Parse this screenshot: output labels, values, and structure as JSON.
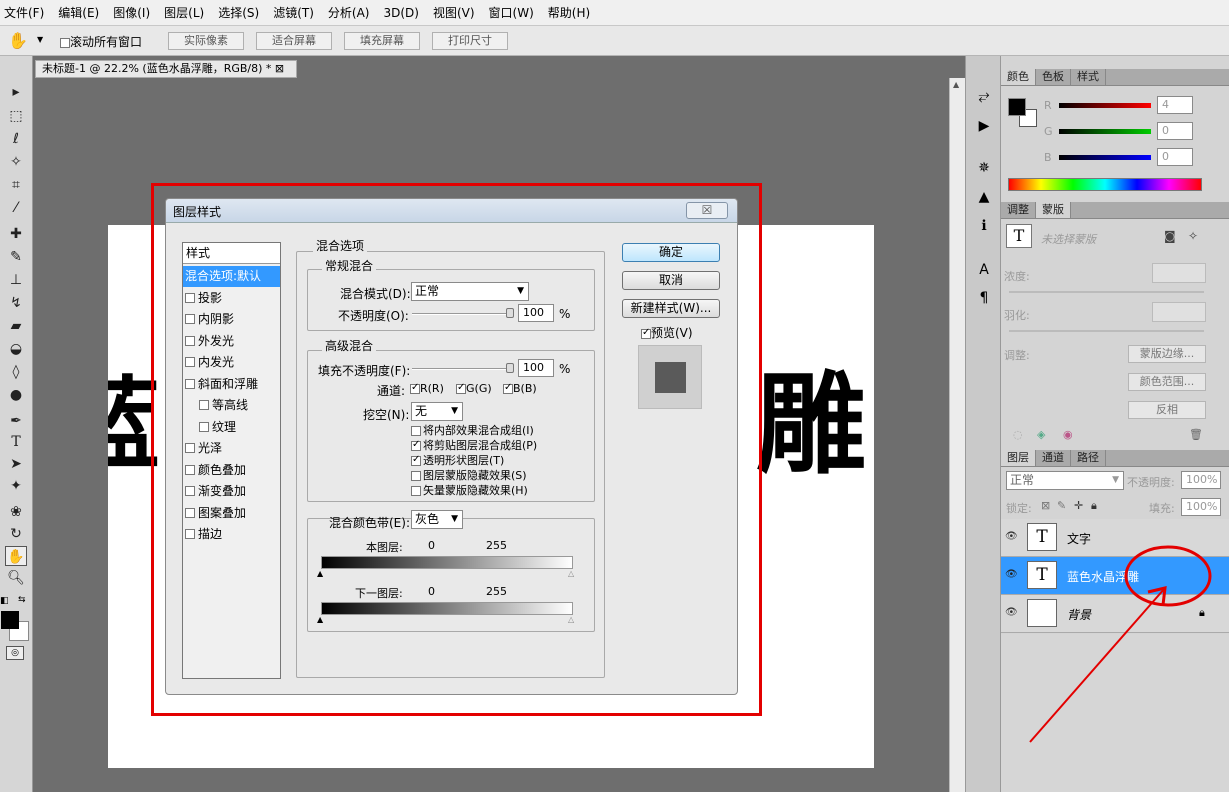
{
  "menu": [
    "文件(F)",
    "编辑(E)",
    "图像(I)",
    "图层(L)",
    "选择(S)",
    "滤镜(T)",
    "分析(A)",
    "3D(D)",
    "视图(V)",
    "窗口(W)",
    "帮助(H)"
  ],
  "options": {
    "scroll_all": "滚动所有窗口",
    "btn_actual": "实际像素",
    "btn_fit": "适合屏幕",
    "btn_fill": "填充屏幕",
    "btn_print": "打印尺寸"
  },
  "document": {
    "tab_title": "未标题-1 @ 22.2% (蓝色水晶浮雕，RGB/8) *",
    "tab_close": "⊠",
    "canvas_char_left": "蓝",
    "canvas_char_right": "雕"
  },
  "dialog": {
    "title": "图层样式",
    "close": "☒",
    "style_header": "样式",
    "styles": [
      {
        "label": "混合选项:默认",
        "checkbox": false,
        "active": true,
        "indent": false
      },
      {
        "label": "投影",
        "checkbox": true,
        "active": false,
        "indent": false
      },
      {
        "label": "内阴影",
        "checkbox": true,
        "active": false,
        "indent": false
      },
      {
        "label": "外发光",
        "checkbox": true,
        "active": false,
        "indent": false
      },
      {
        "label": "内发光",
        "checkbox": true,
        "active": false,
        "indent": false
      },
      {
        "label": "斜面和浮雕",
        "checkbox": true,
        "active": false,
        "indent": false
      },
      {
        "label": "等高线",
        "checkbox": true,
        "active": false,
        "indent": true
      },
      {
        "label": "纹理",
        "checkbox": true,
        "active": false,
        "indent": true
      },
      {
        "label": "光泽",
        "checkbox": true,
        "active": false,
        "indent": false
      },
      {
        "label": "颜色叠加",
        "checkbox": true,
        "active": false,
        "indent": false
      },
      {
        "label": "渐变叠加",
        "checkbox": true,
        "active": false,
        "indent": false
      },
      {
        "label": "图案叠加",
        "checkbox": true,
        "active": false,
        "indent": false
      },
      {
        "label": "描边",
        "checkbox": true,
        "active": false,
        "indent": false
      }
    ],
    "blend_options": "混合选项",
    "general": "常规混合",
    "blend_mode_label": "混合模式(D):",
    "blend_mode_value": "正常",
    "opacity_label": "不透明度(O):",
    "opacity_value": "100",
    "percent": "%",
    "advanced": "高级混合",
    "fill_opacity_label": "填充不透明度(F):",
    "fill_opacity_value": "100",
    "channels_label": "通道:",
    "channels": [
      "R(R)",
      "G(G)",
      "B(B)"
    ],
    "knockout_label": "挖空(N):",
    "knockout_value": "无",
    "adv_options": [
      {
        "label": "将内部效果混合成组(I)",
        "checked": false
      },
      {
        "label": "将剪贴图层混合成组(P)",
        "checked": true
      },
      {
        "label": "透明形状图层(T)",
        "checked": true
      },
      {
        "label": "图层蒙版隐藏效果(S)",
        "checked": false
      },
      {
        "label": "矢量蒙版隐藏效果(H)",
        "checked": false
      }
    ],
    "blend_if_label": "混合颜色带(E):",
    "blend_if_value": "灰色",
    "this_layer_label": "本图层:",
    "this_layer_min": "0",
    "this_layer_max": "255",
    "underlying_label": "下一图层:",
    "underlying_min": "0",
    "underlying_max": "255",
    "ok": "确定",
    "cancel": "取消",
    "new_style": "新建样式(W)...",
    "preview": "预览(V)"
  },
  "color_panel": {
    "tabs": [
      "颜色",
      "色板",
      "样式"
    ],
    "r_label": "R",
    "g_label": "G",
    "b_label": "B",
    "r_value": "4",
    "g_value": "0",
    "b_value": "0"
  },
  "adjust_panel": {
    "tabs": [
      "调整",
      "蒙版"
    ],
    "no_mask": "未选择蒙版",
    "density": "浓度:",
    "feather": "羽化:",
    "refine": "调整:",
    "edge_btn": "蒙版边缘...",
    "color_range_btn": "颜色范围...",
    "invert_btn": "反相"
  },
  "layers_panel": {
    "tabs": [
      "图层",
      "通道",
      "路径"
    ],
    "blend_mode": "正常",
    "opacity_label": "不透明度:",
    "opacity_value": "100%",
    "lock_label": "锁定:",
    "fill_label": "填充:",
    "fill_value": "100%",
    "layers": [
      {
        "name": "文字",
        "thumb": "T",
        "selected": false
      },
      {
        "name": "蓝色水晶浮雕",
        "thumb": "T",
        "selected": true
      },
      {
        "name": "背景",
        "thumb": "",
        "selected": false
      }
    ]
  },
  "colors": {
    "annotation_red": "#e30000",
    "selection_blue": "#3399ff"
  }
}
